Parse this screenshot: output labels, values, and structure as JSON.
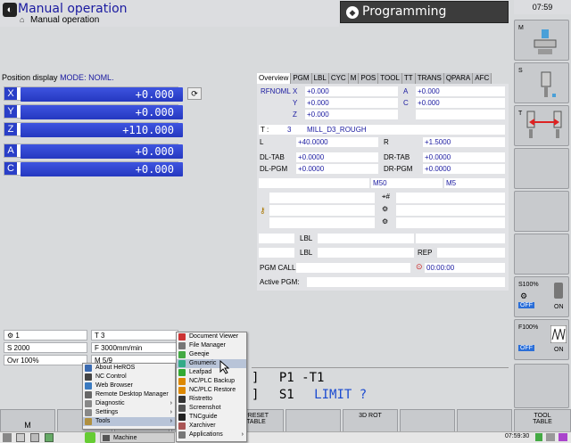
{
  "header": {
    "mode_title": "Manual operation",
    "mode_subtitle": "Manual operation",
    "programming_label": "Programming",
    "clock": "07:59"
  },
  "position_display": {
    "label": "Position display",
    "mode_label": "MODE: NOML.",
    "axes": [
      {
        "axis": "X",
        "value": "+0.000"
      },
      {
        "axis": "Y",
        "value": "+0.000"
      },
      {
        "axis": "Z",
        "value": "+110.000"
      },
      {
        "axis": "A",
        "value": "+0.000"
      },
      {
        "axis": "C",
        "value": "+0.000"
      }
    ]
  },
  "overview": {
    "tabs": [
      "Overview",
      "PGM",
      "LBL",
      "CYC",
      "M",
      "POS",
      "TOOL",
      "TT",
      "TRANS",
      "QPARA",
      "AFC"
    ],
    "rfnoml_label": "RFNOML",
    "rf": [
      {
        "axis": "X",
        "value": "+0.000"
      },
      {
        "axis": "Y",
        "value": "+0.000"
      },
      {
        "axis": "Z",
        "value": "+0.000"
      }
    ],
    "rf2": [
      {
        "axis": "A",
        "value": "+0.000"
      },
      {
        "axis": "C",
        "value": "+0.000"
      }
    ],
    "tool_label": "T :",
    "tool_num": "3",
    "tool_name": "MILL_D3_ROUGH",
    "l_label": "L",
    "l_value": "+40.0000",
    "r_label": "R",
    "r_value": "+1.5000",
    "dltab_label": "DL-TAB",
    "dltab_value": "+0.0000",
    "drtab_label": "DR-TAB",
    "drtab_value": "+0.0000",
    "dlpgm_label": "DL-PGM",
    "dlpgm_value": "+0.0000",
    "drpgm_label": "DR-PGM",
    "drpgm_value": "+0.0000",
    "m50": "M50",
    "m5": "M5",
    "lbl1": "LBL",
    "lbl2": "LBL",
    "rep": "REP",
    "pgm_call": "PGM CALL",
    "timer": "00:00:00",
    "active_pgm": "Active PGM:"
  },
  "status_rows": {
    "t1": "1",
    "tool": "T 3",
    "spindle": "S 2000",
    "feed": "F 3000mm/min",
    "ovr": "Ovr 100%",
    "m": "M 5/9"
  },
  "mdi": {
    "line1": "P1   -T1",
    "line2": "S1",
    "limit": "LIMIT ?"
  },
  "right_softkeys": {
    "m": "M",
    "s": "S",
    "t": "T",
    "s100": "S100%",
    "s100_off": "OFF",
    "s100_on": "ON",
    "f100": "F100%",
    "f100_off": "OFF",
    "f100_on": "ON"
  },
  "bottom_softkeys": {
    "m": "M",
    "preset_line1": "PRESET",
    "preset_line2": "TABLE",
    "rot_line1": "3D ROT",
    "tool_line1": "TOOL",
    "tool_line2": "TABLE"
  },
  "start_menu": [
    {
      "label": "About HeROS",
      "color": "#3a6ab0"
    },
    {
      "label": "NC Control",
      "color": "#444"
    },
    {
      "label": "Web Browser",
      "color": "#3a7ac0"
    },
    {
      "label": "Remote Desktop Manager",
      "color": "#666"
    },
    {
      "label": "Diagnostic",
      "color": "#888",
      "arrow": true
    },
    {
      "label": "Settings",
      "color": "#888",
      "arrow": true
    },
    {
      "label": "Tools",
      "color": "#b09040",
      "arrow": true,
      "selected": true
    }
  ],
  "tools_menu": [
    {
      "label": "Document Viewer",
      "color": "#c33"
    },
    {
      "label": "File Manager",
      "color": "#777"
    },
    {
      "label": "Geeqie",
      "color": "#4a4"
    },
    {
      "label": "Gnumeric",
      "color": "#3a8",
      "selected": true
    },
    {
      "label": "Leafpad",
      "color": "#3a3"
    },
    {
      "label": "NC/PLC Backup",
      "color": "#d80"
    },
    {
      "label": "NC/PLC Restore",
      "color": "#d80"
    },
    {
      "label": "Ristretto",
      "color": "#333"
    },
    {
      "label": "Screenshot",
      "color": "#555"
    },
    {
      "label": "TNCguide",
      "color": "#222"
    },
    {
      "label": "Xarchiver",
      "color": "#a55"
    },
    {
      "label": "Applications",
      "color": "#777",
      "arrow": true
    }
  ],
  "taskbar": {
    "machine": "Machine",
    "clock": "07:59:30"
  }
}
